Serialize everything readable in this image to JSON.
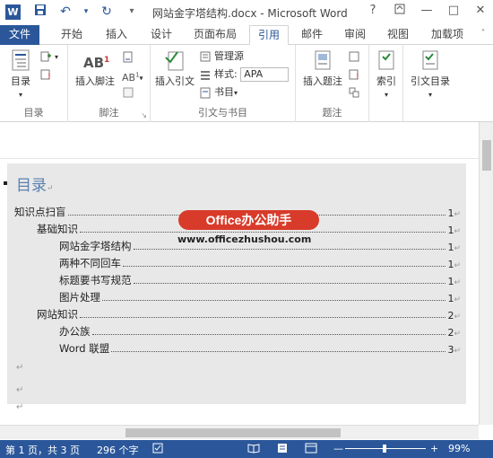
{
  "titlebar": {
    "title": "网站金字塔结构.docx - Microsoft Word",
    "logo_letter": "W",
    "help": "?",
    "minimize": "—",
    "restore": "□",
    "close": "✕"
  },
  "tabs": [
    {
      "label": "文件"
    },
    {
      "label": "开始"
    },
    {
      "label": "插入"
    },
    {
      "label": "设计"
    },
    {
      "label": "页面布局"
    },
    {
      "label": "引用"
    },
    {
      "label": "邮件"
    },
    {
      "label": "审阅"
    },
    {
      "label": "视图"
    },
    {
      "label": "加载项"
    }
  ],
  "ribbon": {
    "toc_group": {
      "label": "目录",
      "btn": "目录"
    },
    "footnote_group": {
      "label": "脚注",
      "btn": "插入脚注"
    },
    "citation_group": {
      "label": "引文与书目",
      "insert_citation": "插入引文",
      "manage_sources": "管理源",
      "style_label": "样式:",
      "style_value": "APA",
      "bibliography": "书目"
    },
    "caption_group": {
      "label": "题注",
      "btn": "插入题注"
    },
    "index_group": {
      "btn": "索引"
    },
    "toa_group": {
      "btn": "引文目录"
    }
  },
  "document": {
    "heading": "目录",
    "toc": [
      {
        "label": "知识点扫盲",
        "page": "1"
      },
      {
        "label": "基础知识",
        "page": "1"
      },
      {
        "label": "网站金字塔结构",
        "page": "1"
      },
      {
        "label": "两种不同回车",
        "page": "1"
      },
      {
        "label": "标题要书写规范",
        "page": "1"
      },
      {
        "label": "图片处理",
        "page": "1"
      },
      {
        "label": "网站知识",
        "page": "2"
      },
      {
        "label": "办公族",
        "page": "2"
      },
      {
        "label": "Word 联盟",
        "page": "3"
      }
    ],
    "para_mark": "↵",
    "watermark_text": "Office办公助手",
    "watermark_url": "www.officezhushou.com"
  },
  "statusbar": {
    "page_info": "第 1 页，共 3 页",
    "word_count": "296 个字",
    "zoom_minus": "—",
    "zoom_plus": "+",
    "zoom": "99%"
  },
  "colors": {
    "accent": "#2b579a",
    "watermark": "#d83b2a"
  }
}
